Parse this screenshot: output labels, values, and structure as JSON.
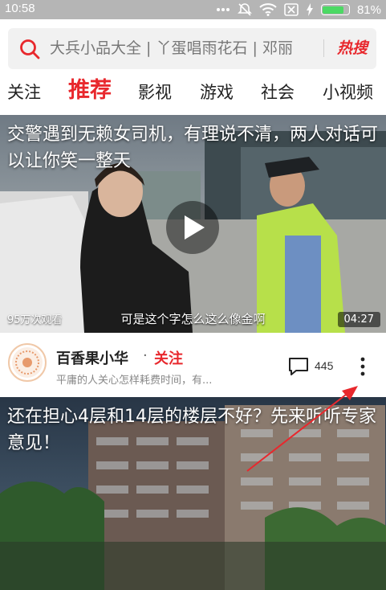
{
  "status_bar": {
    "time": "10:58",
    "icons": [
      "more-dots-icon",
      "mute-icon",
      "wifi-icon",
      "sim-off-icon",
      "charging-icon",
      "battery-icon"
    ],
    "battery_percent": "81%",
    "battery_level": 0.81
  },
  "search": {
    "placeholder": "大兵小品大全 | 丫蛋唱雨花石 | 邓丽",
    "hot_label": "热搜"
  },
  "tabs": [
    {
      "label": "关注",
      "active": false
    },
    {
      "label": "推荐",
      "active": true
    },
    {
      "label": "影视",
      "active": false
    },
    {
      "label": "游戏",
      "active": false
    },
    {
      "label": "社会",
      "active": false
    },
    {
      "label": "小视频",
      "active": false
    }
  ],
  "video": {
    "title": "交警遇到无赖女司机，有理说不清，两人对话可以让你笑一整天",
    "views": "95万次观看",
    "subtitle": "可是这个字怎么这么像金啊",
    "duration": "04:27"
  },
  "author": {
    "name": "百香果小华",
    "separator": "·",
    "follow_label": "关注",
    "description": "平庸的人关心怎样耗费时间，有...",
    "comment_count": "445"
  },
  "card2": {
    "title": "还在担心4层和14层的楼层不好？先来听听专家意见！"
  },
  "colors": {
    "accent": "#e8282d",
    "battery": "#4cd964",
    "status_bar": "#b5b5b5"
  }
}
